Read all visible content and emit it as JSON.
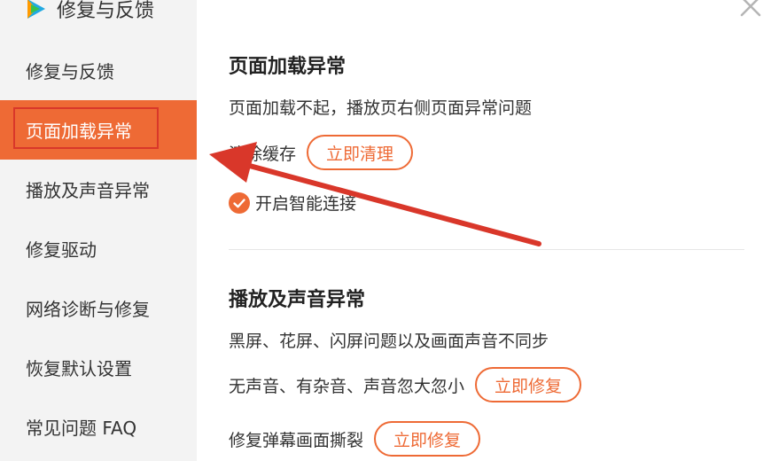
{
  "app": {
    "title": "修复与反馈"
  },
  "sidebar": {
    "items": [
      {
        "label": "修复与反馈",
        "active": false
      },
      {
        "label": "页面加载异常",
        "active": true
      },
      {
        "label": "播放及声音异常",
        "active": false
      },
      {
        "label": "修复驱动",
        "active": false
      },
      {
        "label": "网络诊断与修复",
        "active": false
      },
      {
        "label": "恢复默认设置",
        "active": false
      },
      {
        "label": "常见问题 FAQ",
        "active": false
      }
    ]
  },
  "sections": {
    "page_load": {
      "title": "页面加载异常",
      "description": "页面加载不起，播放页右侧页面异常问题",
      "clear_cache_label": "清除缓存",
      "clear_now_button": "立即清理",
      "smart_connect_label": "开启智能连接",
      "smart_connect_checked": true
    },
    "playback": {
      "title": "播放及声音异常",
      "description": "黑屏、花屏、闪屏问题以及画面声音不同步",
      "audio_issue_label": "无声音、有杂音、声音忽大忽小",
      "audio_fix_button": "立即修复",
      "danmaku_issue_label": "修复弹幕画面撕裂",
      "danmaku_fix_button": "立即修复"
    }
  },
  "icons": {
    "logo": "video-app-logo-icon",
    "close": "close-icon",
    "check": "check-circle-icon"
  },
  "colors": {
    "accent": "#ee6a35",
    "annotation": "#d9372a",
    "sidebar_bg": "#f3f3f3"
  }
}
